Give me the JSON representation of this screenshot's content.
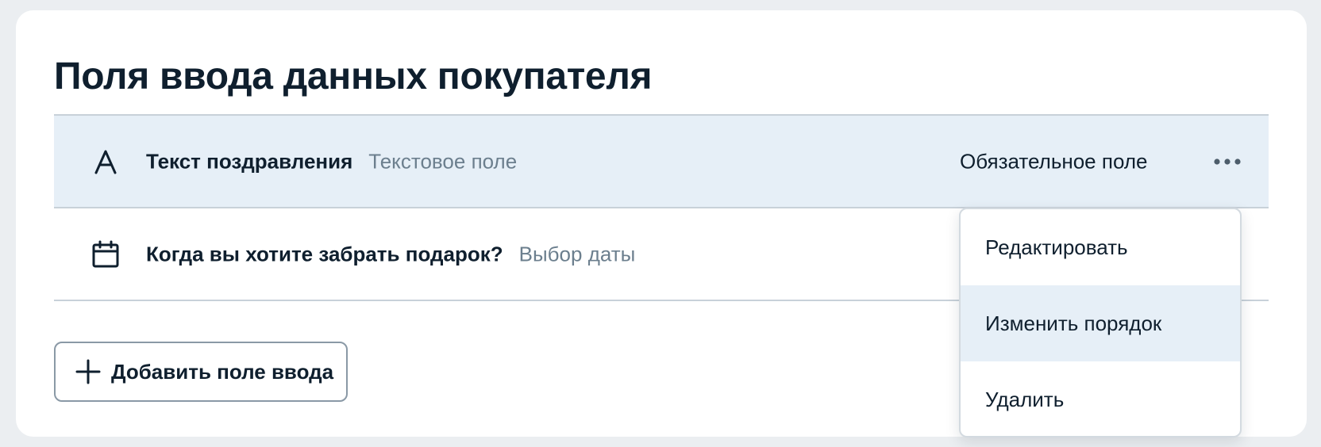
{
  "page": {
    "title": "Поля ввода данных покупателя"
  },
  "fields": [
    {
      "name": "Текст поздравления",
      "type": "Текстовое поле",
      "required_label": "Обязательное поле",
      "icon": "text-field-icon"
    },
    {
      "name": "Когда вы хотите забрать подарок?",
      "type": "Выбор даты",
      "icon": "calendar-icon"
    }
  ],
  "add_button": {
    "label": "Добавить поле ввода",
    "icon": "plus-icon"
  },
  "menu": {
    "items": [
      {
        "label": "Редактировать"
      },
      {
        "label": "Изменить порядок"
      },
      {
        "label": "Удалить"
      }
    ],
    "hovered_item": "Изменить порядок"
  },
  "colors": {
    "background": "#ebeef1",
    "text_primary": "#0f1f2e",
    "text_secondary": "#6c7f8e",
    "row_highlight": "#e6eff7",
    "divider": "#c8d1d9"
  }
}
